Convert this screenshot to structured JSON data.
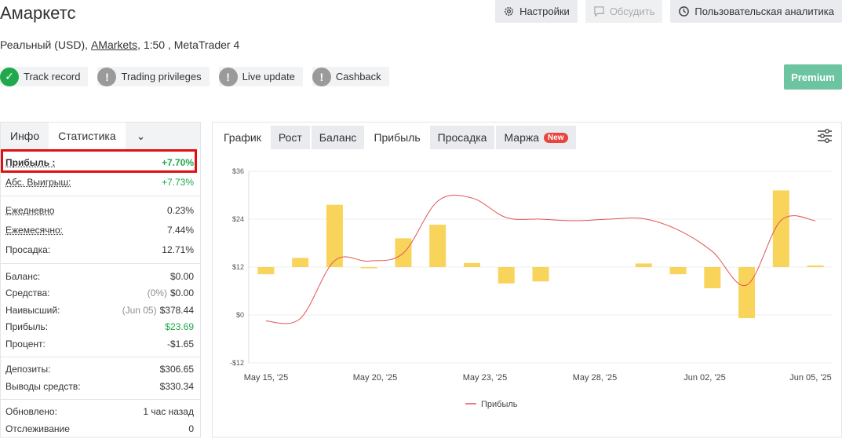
{
  "header": {
    "title": "Амаркетс",
    "subtitle_prefix": "Реальный (USD), ",
    "subtitle_link": "AMarkets",
    "subtitle_suffix": ", 1:50 , MetaTrader 4",
    "buttons": [
      {
        "label": "Настройки",
        "icon": "gear-icon"
      },
      {
        "label": "Обсудить",
        "icon": "chat-icon"
      },
      {
        "label": "Пользовательская аналитика",
        "icon": "clock-icon"
      }
    ]
  },
  "badges": [
    {
      "label": "Track record",
      "status": "ok"
    },
    {
      "label": "Trading privileges",
      "status": "warn"
    },
    {
      "label": "Live update",
      "status": "warn"
    },
    {
      "label": "Cashback",
      "status": "warn"
    }
  ],
  "premium_label": "Premium",
  "left_tabs": {
    "info": "Инфо",
    "stats": "Статистика",
    "chevron": "⌄"
  },
  "stats": {
    "profit": {
      "k": "Прибыль :",
      "v": "+7.70%"
    },
    "abs_gain": {
      "k": "Абс. Выигрыш:",
      "v": "+7.73%"
    },
    "daily": {
      "k": "Ежедневно",
      "v": "0.23%"
    },
    "monthly": {
      "k": "Ежемесячно:",
      "v": "7.44%"
    },
    "drawdown": {
      "k": "Просадка:",
      "v": "12.71%"
    },
    "balance": {
      "k": "Баланс:",
      "v": "$0.00"
    },
    "equity": {
      "k": "Средства:",
      "muted": "(0%)",
      "v": "$0.00"
    },
    "highest": {
      "k": "Наивысший:",
      "muted": "(Jun 05)",
      "v": "$378.44"
    },
    "profit_abs": {
      "k": "Прибыль:",
      "v": "$23.69"
    },
    "interest": {
      "k": "Процент:",
      "v": "-$1.65"
    },
    "deposits": {
      "k": "Депозиты:",
      "v": "$306.65"
    },
    "withdrawals": {
      "k": "Выводы средств:",
      "v": "$330.34"
    },
    "updated": {
      "k": "Обновлено:",
      "v": "1 час назад"
    },
    "tracking": {
      "k": "Отслеживание",
      "v": "0"
    }
  },
  "right_tabs": {
    "graph": "График",
    "growth": "Рост",
    "balance": "Баланс",
    "profit": "Прибыль",
    "drawdown": "Просадка",
    "margin": "Маржа",
    "new": "New"
  },
  "colors": {
    "bar": "#f9d45b",
    "line": "#e05555",
    "ok": "#1fa84c",
    "highlight": "#e01010"
  },
  "chart_data": {
    "type": "bar",
    "y_ticks": [
      "$36",
      "$24",
      "$12",
      "$0",
      "-$12"
    ],
    "ylim": [
      -12,
      36
    ],
    "x_ticks": [
      "May 15, '25",
      "May 20, '25",
      "May 23, '25",
      "May 28, '25",
      "Jun 02, '25",
      "Jun 05, '25"
    ],
    "bars": [
      -1.8,
      2.3,
      15.6,
      -0.3,
      7.2,
      10.6,
      1.0,
      -4.1,
      -3.6,
      0,
      0,
      0.9,
      -1.8,
      -5.3,
      -12.8,
      19.2,
      0.4
    ],
    "series": [
      {
        "name": "Прибыль",
        "values": [
          -1.5,
          -0.9,
          13.6,
          13.5,
          15.5,
          28.5,
          29.3,
          24.4,
          24.0,
          23.6,
          24.0,
          24.1,
          21.3,
          15.9,
          7.5,
          23.7,
          23.6
        ]
      }
    ]
  }
}
